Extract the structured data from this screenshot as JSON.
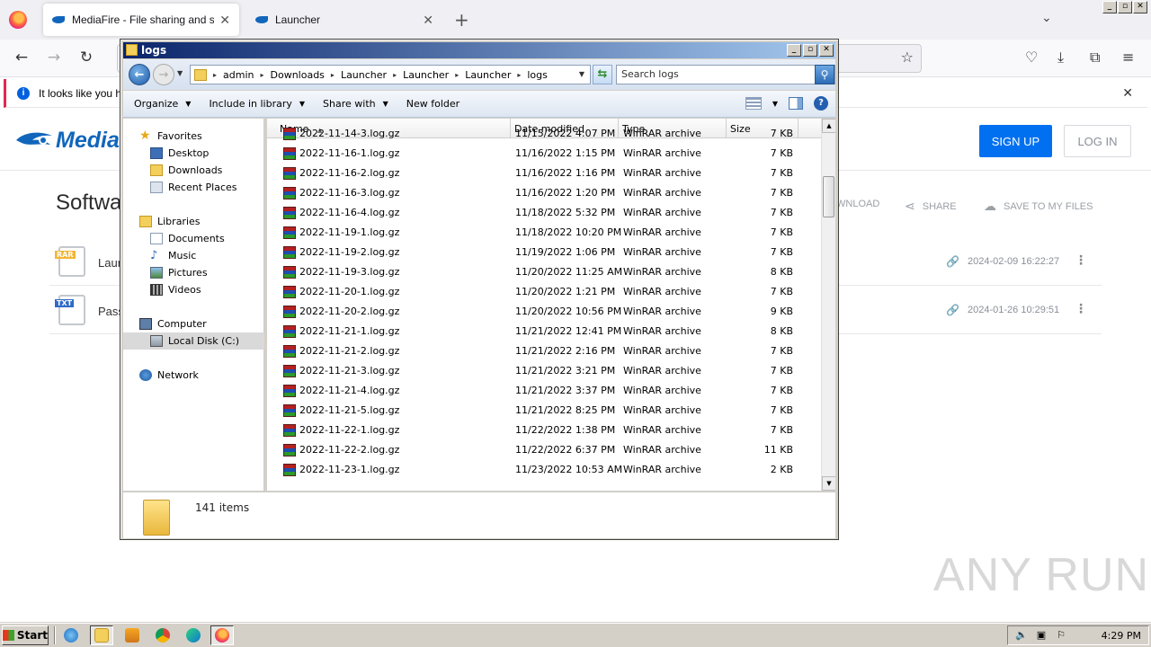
{
  "firefox": {
    "tabs": [
      {
        "title": "MediaFire - File sharing and storag",
        "active": true
      },
      {
        "title": "Launcher",
        "active": false
      }
    ],
    "new_tab": "+",
    "tab_list": "⌄",
    "window_controls": [
      "_",
      "▫",
      "✕"
    ]
  },
  "infobar": {
    "text": "It looks like you ha"
  },
  "mediafire": {
    "logo_text": "Media",
    "sign_up": "SIGN UP",
    "log_in": "LOG IN",
    "heading": "Softwa",
    "actions": {
      "download": "WNLOAD",
      "share": "SHARE",
      "save": "SAVE TO MY FILES"
    },
    "files": [
      {
        "icon_tag": "RAR",
        "name": "Laur",
        "date": "2024-02-09 16:22:27"
      },
      {
        "icon_tag": "TXT",
        "name": "Pass",
        "date": "2024-01-26 10:29:51"
      }
    ]
  },
  "explorer": {
    "title": "logs",
    "breadcrumb": [
      "admin",
      "Downloads",
      "Launcher",
      "Launcher",
      "Launcher",
      "logs"
    ],
    "search_placeholder": "Search logs",
    "toolbar": {
      "organize": "Organize",
      "include": "Include in library",
      "share": "Share with",
      "new_folder": "New folder"
    },
    "nav": {
      "favorites": "Favorites",
      "desktop": "Desktop",
      "downloads": "Downloads",
      "recent": "Recent Places",
      "libraries": "Libraries",
      "documents": "Documents",
      "music": "Music",
      "pictures": "Pictures",
      "videos": "Videos",
      "computer": "Computer",
      "local_disk": "Local Disk (C:)",
      "network": "Network"
    },
    "columns": {
      "name": "Name",
      "date": "Date modified",
      "type": "Type",
      "size": "Size"
    },
    "files": [
      {
        "name": "2022-11-14-3.log.gz",
        "date": "11/15/2022 4:07 PM",
        "type": "WinRAR archive",
        "size": "7 KB"
      },
      {
        "name": "2022-11-16-1.log.gz",
        "date": "11/16/2022 1:15 PM",
        "type": "WinRAR archive",
        "size": "7 KB"
      },
      {
        "name": "2022-11-16-2.log.gz",
        "date": "11/16/2022 1:16 PM",
        "type": "WinRAR archive",
        "size": "7 KB"
      },
      {
        "name": "2022-11-16-3.log.gz",
        "date": "11/16/2022 1:20 PM",
        "type": "WinRAR archive",
        "size": "7 KB"
      },
      {
        "name": "2022-11-16-4.log.gz",
        "date": "11/18/2022 5:32 PM",
        "type": "WinRAR archive",
        "size": "7 KB"
      },
      {
        "name": "2022-11-19-1.log.gz",
        "date": "11/18/2022 10:20 PM",
        "type": "WinRAR archive",
        "size": "7 KB"
      },
      {
        "name": "2022-11-19-2.log.gz",
        "date": "11/19/2022 1:06 PM",
        "type": "WinRAR archive",
        "size": "7 KB"
      },
      {
        "name": "2022-11-19-3.log.gz",
        "date": "11/20/2022 11:25 AM",
        "type": "WinRAR archive",
        "size": "8 KB"
      },
      {
        "name": "2022-11-20-1.log.gz",
        "date": "11/20/2022 1:21 PM",
        "type": "WinRAR archive",
        "size": "7 KB"
      },
      {
        "name": "2022-11-20-2.log.gz",
        "date": "11/20/2022 10:56 PM",
        "type": "WinRAR archive",
        "size": "9 KB"
      },
      {
        "name": "2022-11-21-1.log.gz",
        "date": "11/21/2022 12:41 PM",
        "type": "WinRAR archive",
        "size": "8 KB"
      },
      {
        "name": "2022-11-21-2.log.gz",
        "date": "11/21/2022 2:16 PM",
        "type": "WinRAR archive",
        "size": "7 KB"
      },
      {
        "name": "2022-11-21-3.log.gz",
        "date": "11/21/2022 3:21 PM",
        "type": "WinRAR archive",
        "size": "7 KB"
      },
      {
        "name": "2022-11-21-4.log.gz",
        "date": "11/21/2022 3:37 PM",
        "type": "WinRAR archive",
        "size": "7 KB"
      },
      {
        "name": "2022-11-21-5.log.gz",
        "date": "11/21/2022 8:25 PM",
        "type": "WinRAR archive",
        "size": "7 KB"
      },
      {
        "name": "2022-11-22-1.log.gz",
        "date": "11/22/2022 1:38 PM",
        "type": "WinRAR archive",
        "size": "7 KB"
      },
      {
        "name": "2022-11-22-2.log.gz",
        "date": "11/22/2022 6:37 PM",
        "type": "WinRAR archive",
        "size": "11 KB"
      },
      {
        "name": "2022-11-23-1.log.gz",
        "date": "11/23/2022 10:53 AM",
        "type": "WinRAR archive",
        "size": "2 KB"
      }
    ],
    "item_count": "141 items"
  },
  "taskbar": {
    "start": "Start",
    "clock": "4:29 PM"
  },
  "watermark": "ANY RUN"
}
